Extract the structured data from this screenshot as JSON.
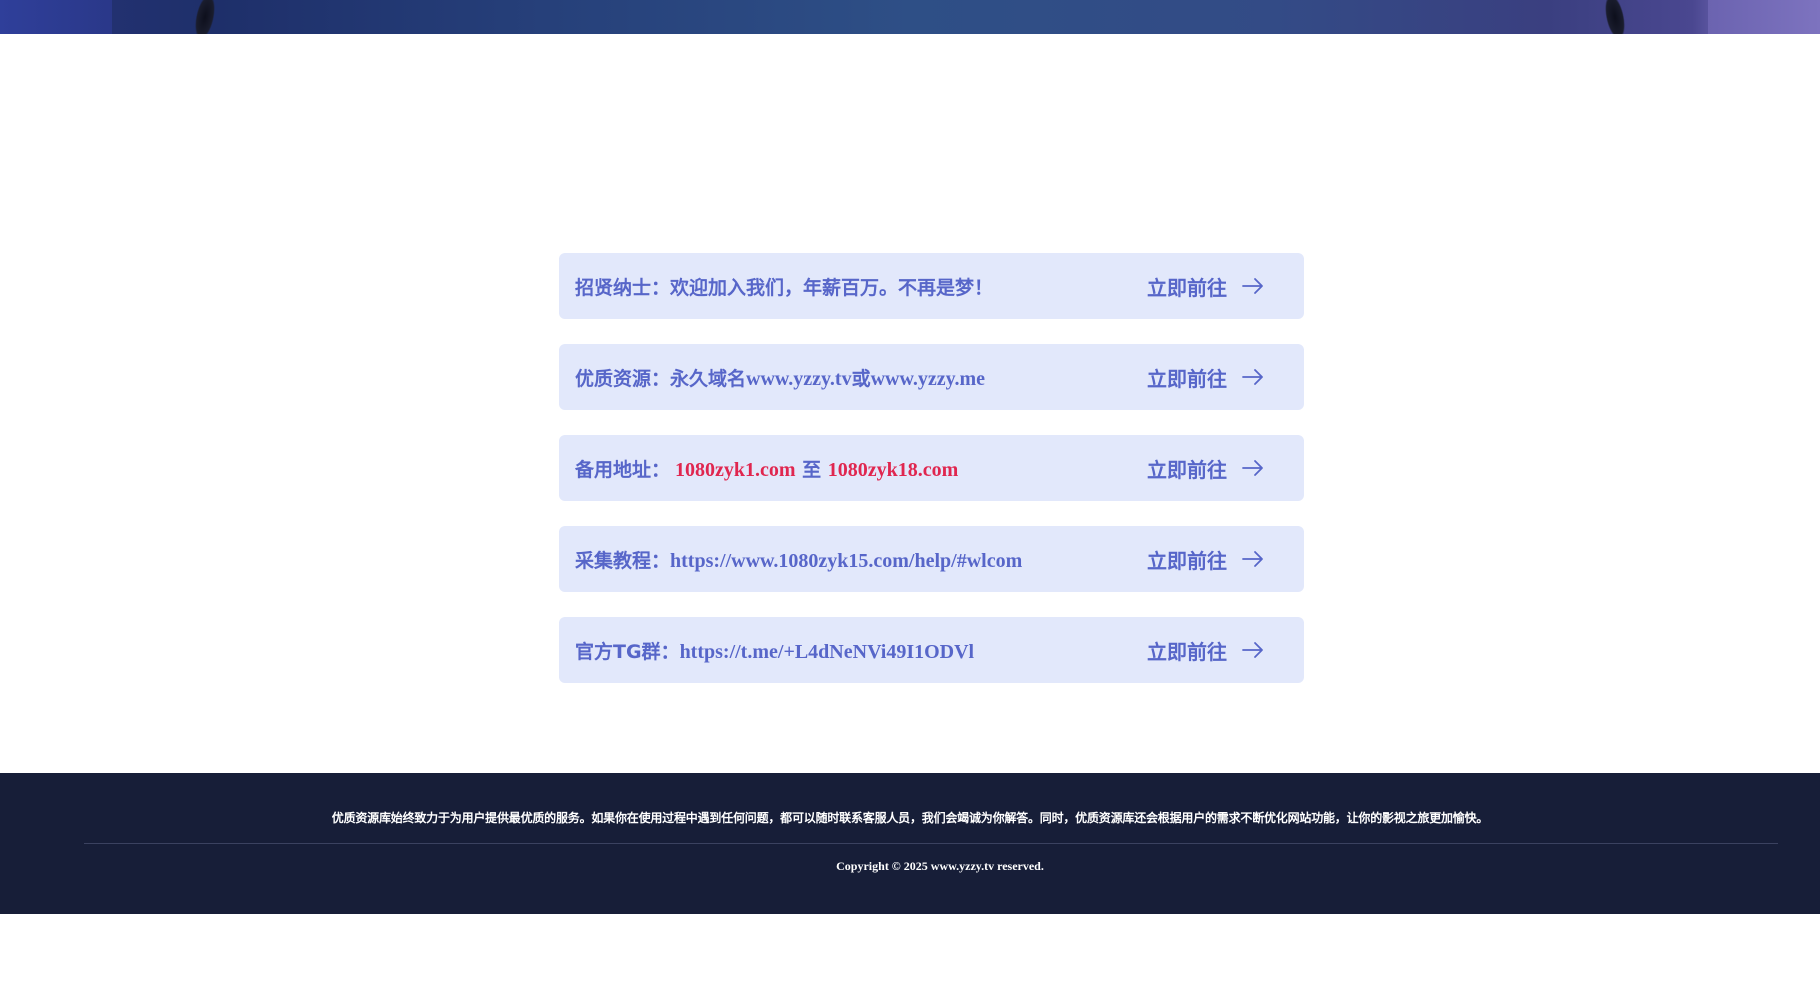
{
  "links": [
    {
      "label": "招贤纳士：",
      "parts": [
        {
          "text": "欢迎加入我们，年薪百万。不再是梦！",
          "style": "cjk"
        }
      ],
      "action": "立即前往"
    },
    {
      "label": "优质资源：",
      "parts": [
        {
          "text": "永久域名",
          "style": "cjk"
        },
        {
          "text": "www.yzzy.tv",
          "style": "latin"
        },
        {
          "text": "或",
          "style": "cjk"
        },
        {
          "text": "www.yzzy.me",
          "style": "latin"
        }
      ],
      "action": "立即前往"
    },
    {
      "label": "备用地址：",
      "parts": [
        {
          "text": " 1080zyk1.com",
          "style": "red"
        },
        {
          "text": " 至 ",
          "style": "cjk"
        },
        {
          "text": "1080zyk18.com",
          "style": "red"
        }
      ],
      "action": "立即前往"
    },
    {
      "label": "采集教程：",
      "parts": [
        {
          "text": "https://www.1080zyk15.com/help/#wlcom",
          "style": "latin"
        }
      ],
      "action": "立即前往"
    },
    {
      "label": "官方TG群：",
      "parts": [
        {
          "text": "https://t.me/+L4dNeNVi49I1ODVl",
          "style": "latin"
        }
      ],
      "action": "立即前往"
    }
  ],
  "footer": {
    "description": "优质资源库始终致力于为用户提供最优质的服务。如果你在使用过程中遇到任何问题，都可以随时联系客服人员，我们会竭诚为你解答。同时，优质资源库还会根据用户的需求不断优化网站功能，让你的影视之旅更加愉快。",
    "copyright": "Copyright © 2025 www.yzzy.tv reserved."
  },
  "colors": {
    "card_bg": "#e2e8fb",
    "link_text": "#5766c9",
    "highlight_red": "#e0264f",
    "footer_bg": "#171e38"
  },
  "icons": {
    "action_icon": "arrow-right-icon"
  }
}
